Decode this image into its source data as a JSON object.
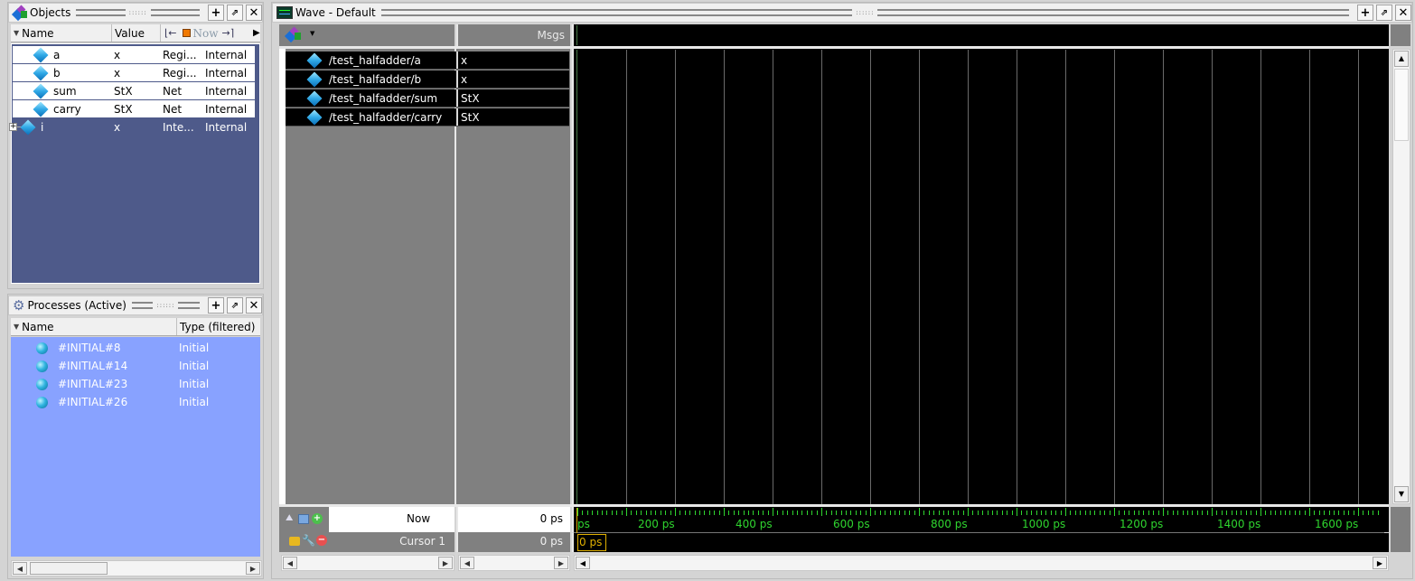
{
  "objects_panel": {
    "title": "Objects",
    "columns": [
      "Name",
      "Value"
    ],
    "toolbar": {
      "now_label": "Now"
    },
    "rows": [
      {
        "name": "a",
        "value": "x",
        "kind": "Regi...",
        "mode": "Internal",
        "selected": true
      },
      {
        "name": "b",
        "value": "x",
        "kind": "Regi...",
        "mode": "Internal",
        "selected": true
      },
      {
        "name": "sum",
        "value": "StX",
        "kind": "Net",
        "mode": "Internal",
        "selected": true
      },
      {
        "name": "carry",
        "value": "StX",
        "kind": "Net",
        "mode": "Internal",
        "selected": true
      },
      {
        "name": "i",
        "value": "x",
        "kind": "Inte...",
        "mode": "Internal",
        "selected": false,
        "expandable": true
      }
    ]
  },
  "processes_panel": {
    "title": "Processes (Active)",
    "columns": [
      "Name",
      "Type (filtered)"
    ],
    "rows": [
      {
        "name": "#INITIAL#8",
        "type": "Initial"
      },
      {
        "name": "#INITIAL#14",
        "type": "Initial"
      },
      {
        "name": "#INITIAL#23",
        "type": "Initial"
      },
      {
        "name": "#INITIAL#26",
        "type": "Initial"
      }
    ]
  },
  "wave_panel": {
    "title": "Wave - Default",
    "msgs_header": "Msgs",
    "signals": [
      {
        "name": "/test_halfadder/a",
        "value": "x"
      },
      {
        "name": "/test_halfadder/b",
        "value": "x"
      },
      {
        "name": "/test_halfadder/sum",
        "value": "StX"
      },
      {
        "name": "/test_halfadder/carry",
        "value": "StX"
      }
    ],
    "now_label": "Now",
    "now_value": "0 ps",
    "cursor_label": "Cursor 1",
    "cursor_value": "0 ps",
    "cursor_marker": "0 ps",
    "ruler": {
      "start_label": "ps",
      "labels": [
        "200 ps",
        "400 ps",
        "600 ps",
        "800 ps",
        "1000 ps",
        "1200 ps",
        "1400 ps",
        "1600 ps"
      ],
      "label_values_ps": [
        200,
        400,
        600,
        800,
        1000,
        1200,
        1400,
        1600
      ],
      "major_step_ps": 100,
      "minor_step_ps": 10,
      "range_ps": [
        0,
        1640
      ]
    },
    "colors": {
      "wave_bg": "#000000",
      "ruler_text": "#2fd52f",
      "cursor": "#e0b000",
      "grid": "#6a6a6a"
    }
  }
}
